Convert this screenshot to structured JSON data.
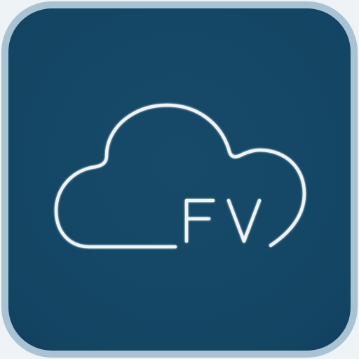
{
  "icon": {
    "semantic": "cloud-icon",
    "logo_text": "FV"
  },
  "colors": {
    "tile": "#144766",
    "tile_edge": "#9fbccf",
    "outline": "#eef4f8"
  }
}
